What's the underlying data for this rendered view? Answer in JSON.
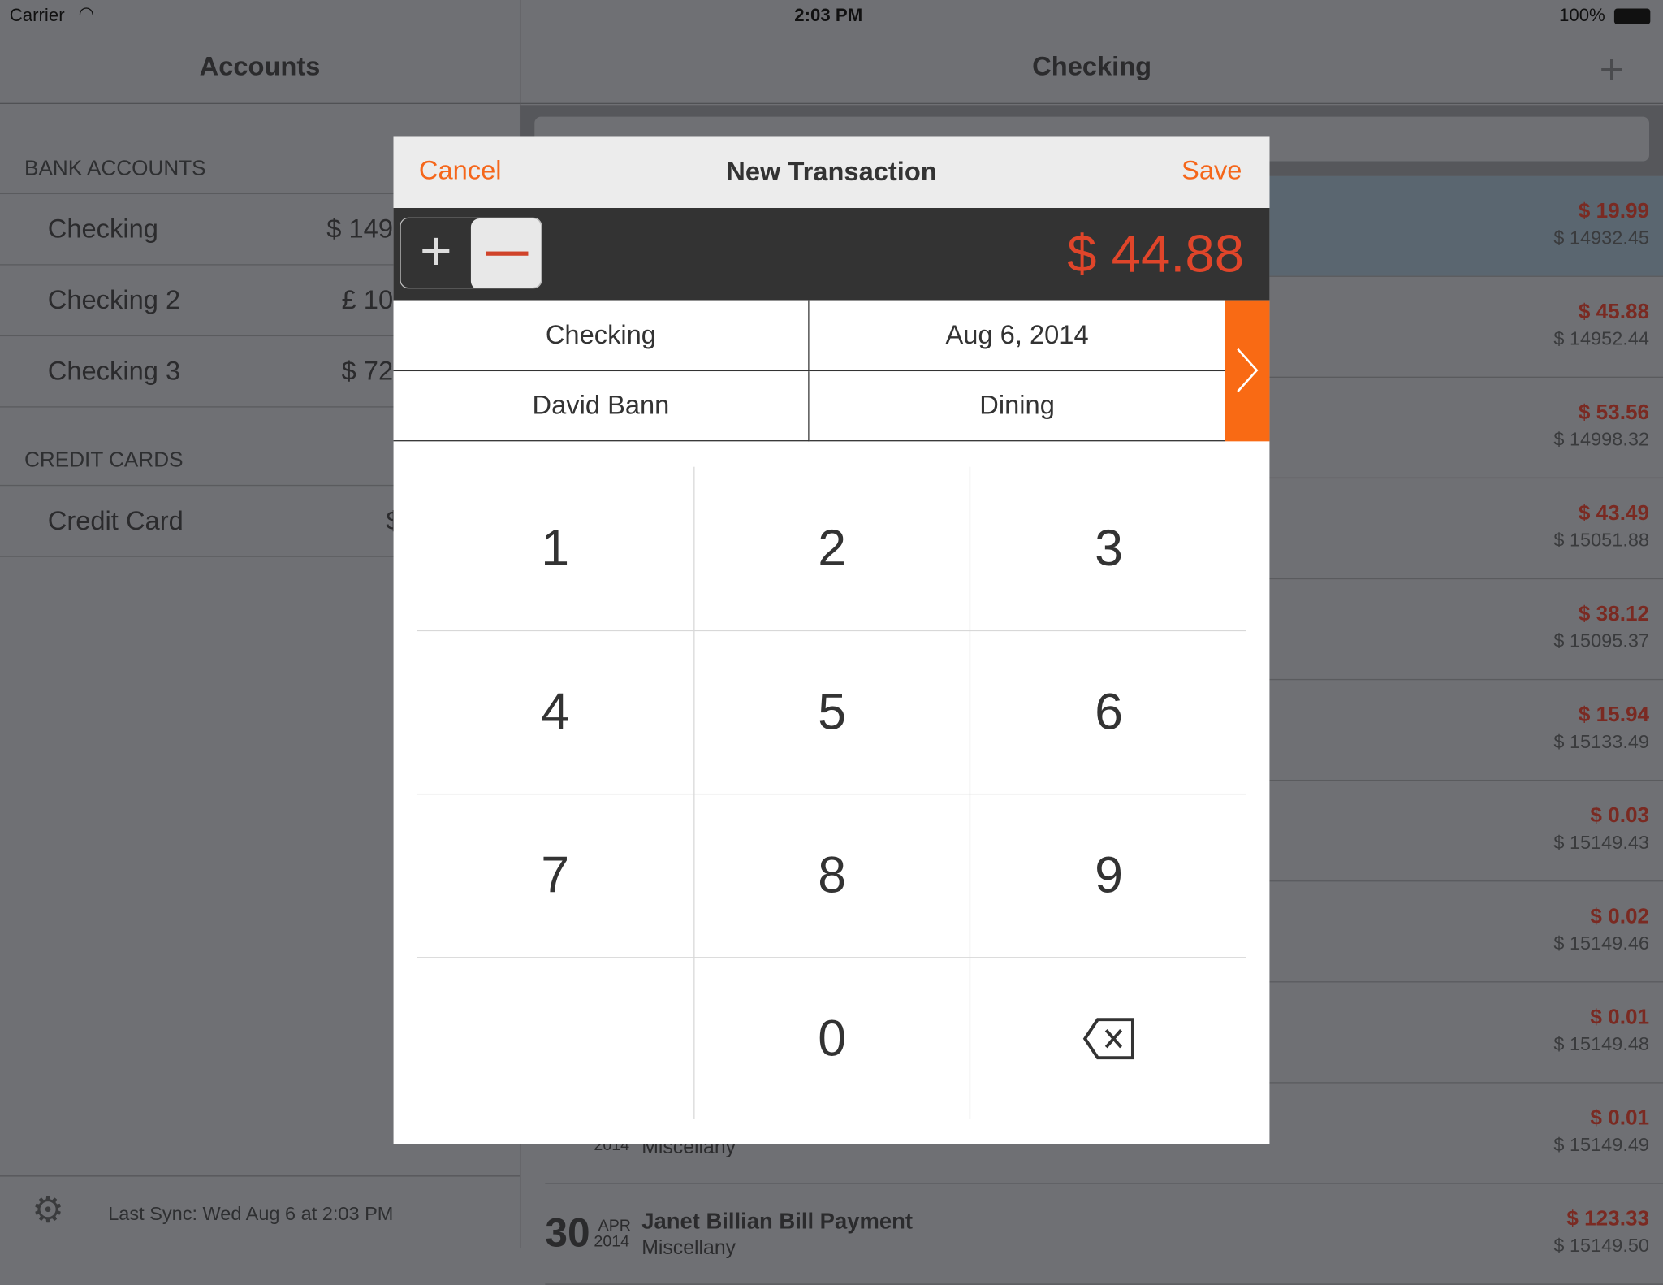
{
  "status_bar": {
    "carrier": "Carrier",
    "time": "2:03 PM",
    "battery": "100%"
  },
  "accounts_pane": {
    "title": "Accounts",
    "sections": [
      {
        "header": "BANK ACCOUNTS",
        "items": [
          {
            "name": "Checking",
            "balance": "$ 149"
          },
          {
            "name": "Checking 2",
            "balance": "£ 10"
          },
          {
            "name": "Checking 3",
            "balance": "$ 72"
          }
        ]
      },
      {
        "header": "CREDIT CARDS",
        "items": [
          {
            "name": "Credit Card",
            "balance": "$"
          }
        ]
      }
    ],
    "last_sync": "Last Sync: Wed Aug 6 at 2:03 PM"
  },
  "register_pane": {
    "title": "Checking",
    "transactions": [
      {
        "amount": "$ 19.99",
        "balance": "$ 14932.45",
        "selected": true
      },
      {
        "amount": "$ 45.88",
        "balance": "$ 14952.44"
      },
      {
        "amount": "$ 53.56",
        "balance": "$ 14998.32"
      },
      {
        "amount": "$ 43.49",
        "balance": "$ 15051.88"
      },
      {
        "amount": "$ 38.12",
        "balance": "$ 15095.37"
      },
      {
        "amount": "$ 15.94",
        "balance": "$ 15133.49"
      },
      {
        "amount": "$ 0.03",
        "balance": "$ 15149.43"
      },
      {
        "amount": "$ 0.02",
        "balance": "$ 15149.46"
      },
      {
        "amount": "$ 0.01",
        "balance": "$ 15149.48"
      },
      {
        "amount": "$ 0.01",
        "balance": "$ 15149.49",
        "category": "Miscellany",
        "year": "2014"
      },
      {
        "amount": "$ 123.33",
        "balance": "$ 15149.50",
        "day": "30",
        "month": "APR",
        "year": "2014",
        "payee": "Janet Billian Bill Payment",
        "category": "Miscellany"
      }
    ]
  },
  "modal": {
    "title": "New Transaction",
    "cancel": "Cancel",
    "save": "Save",
    "amount": "$ 44.88",
    "account": "Checking",
    "date": "Aug 6, 2014",
    "payee": "David Bann",
    "category": "Dining",
    "keys": [
      "1",
      "2",
      "3",
      "4",
      "5",
      "6",
      "7",
      "8",
      "9",
      "",
      "0",
      "backspace-icon"
    ]
  },
  "colors": {
    "accent": "#f5661a",
    "amount_red": "#e0452a",
    "arrow_button": "#f96a14"
  }
}
